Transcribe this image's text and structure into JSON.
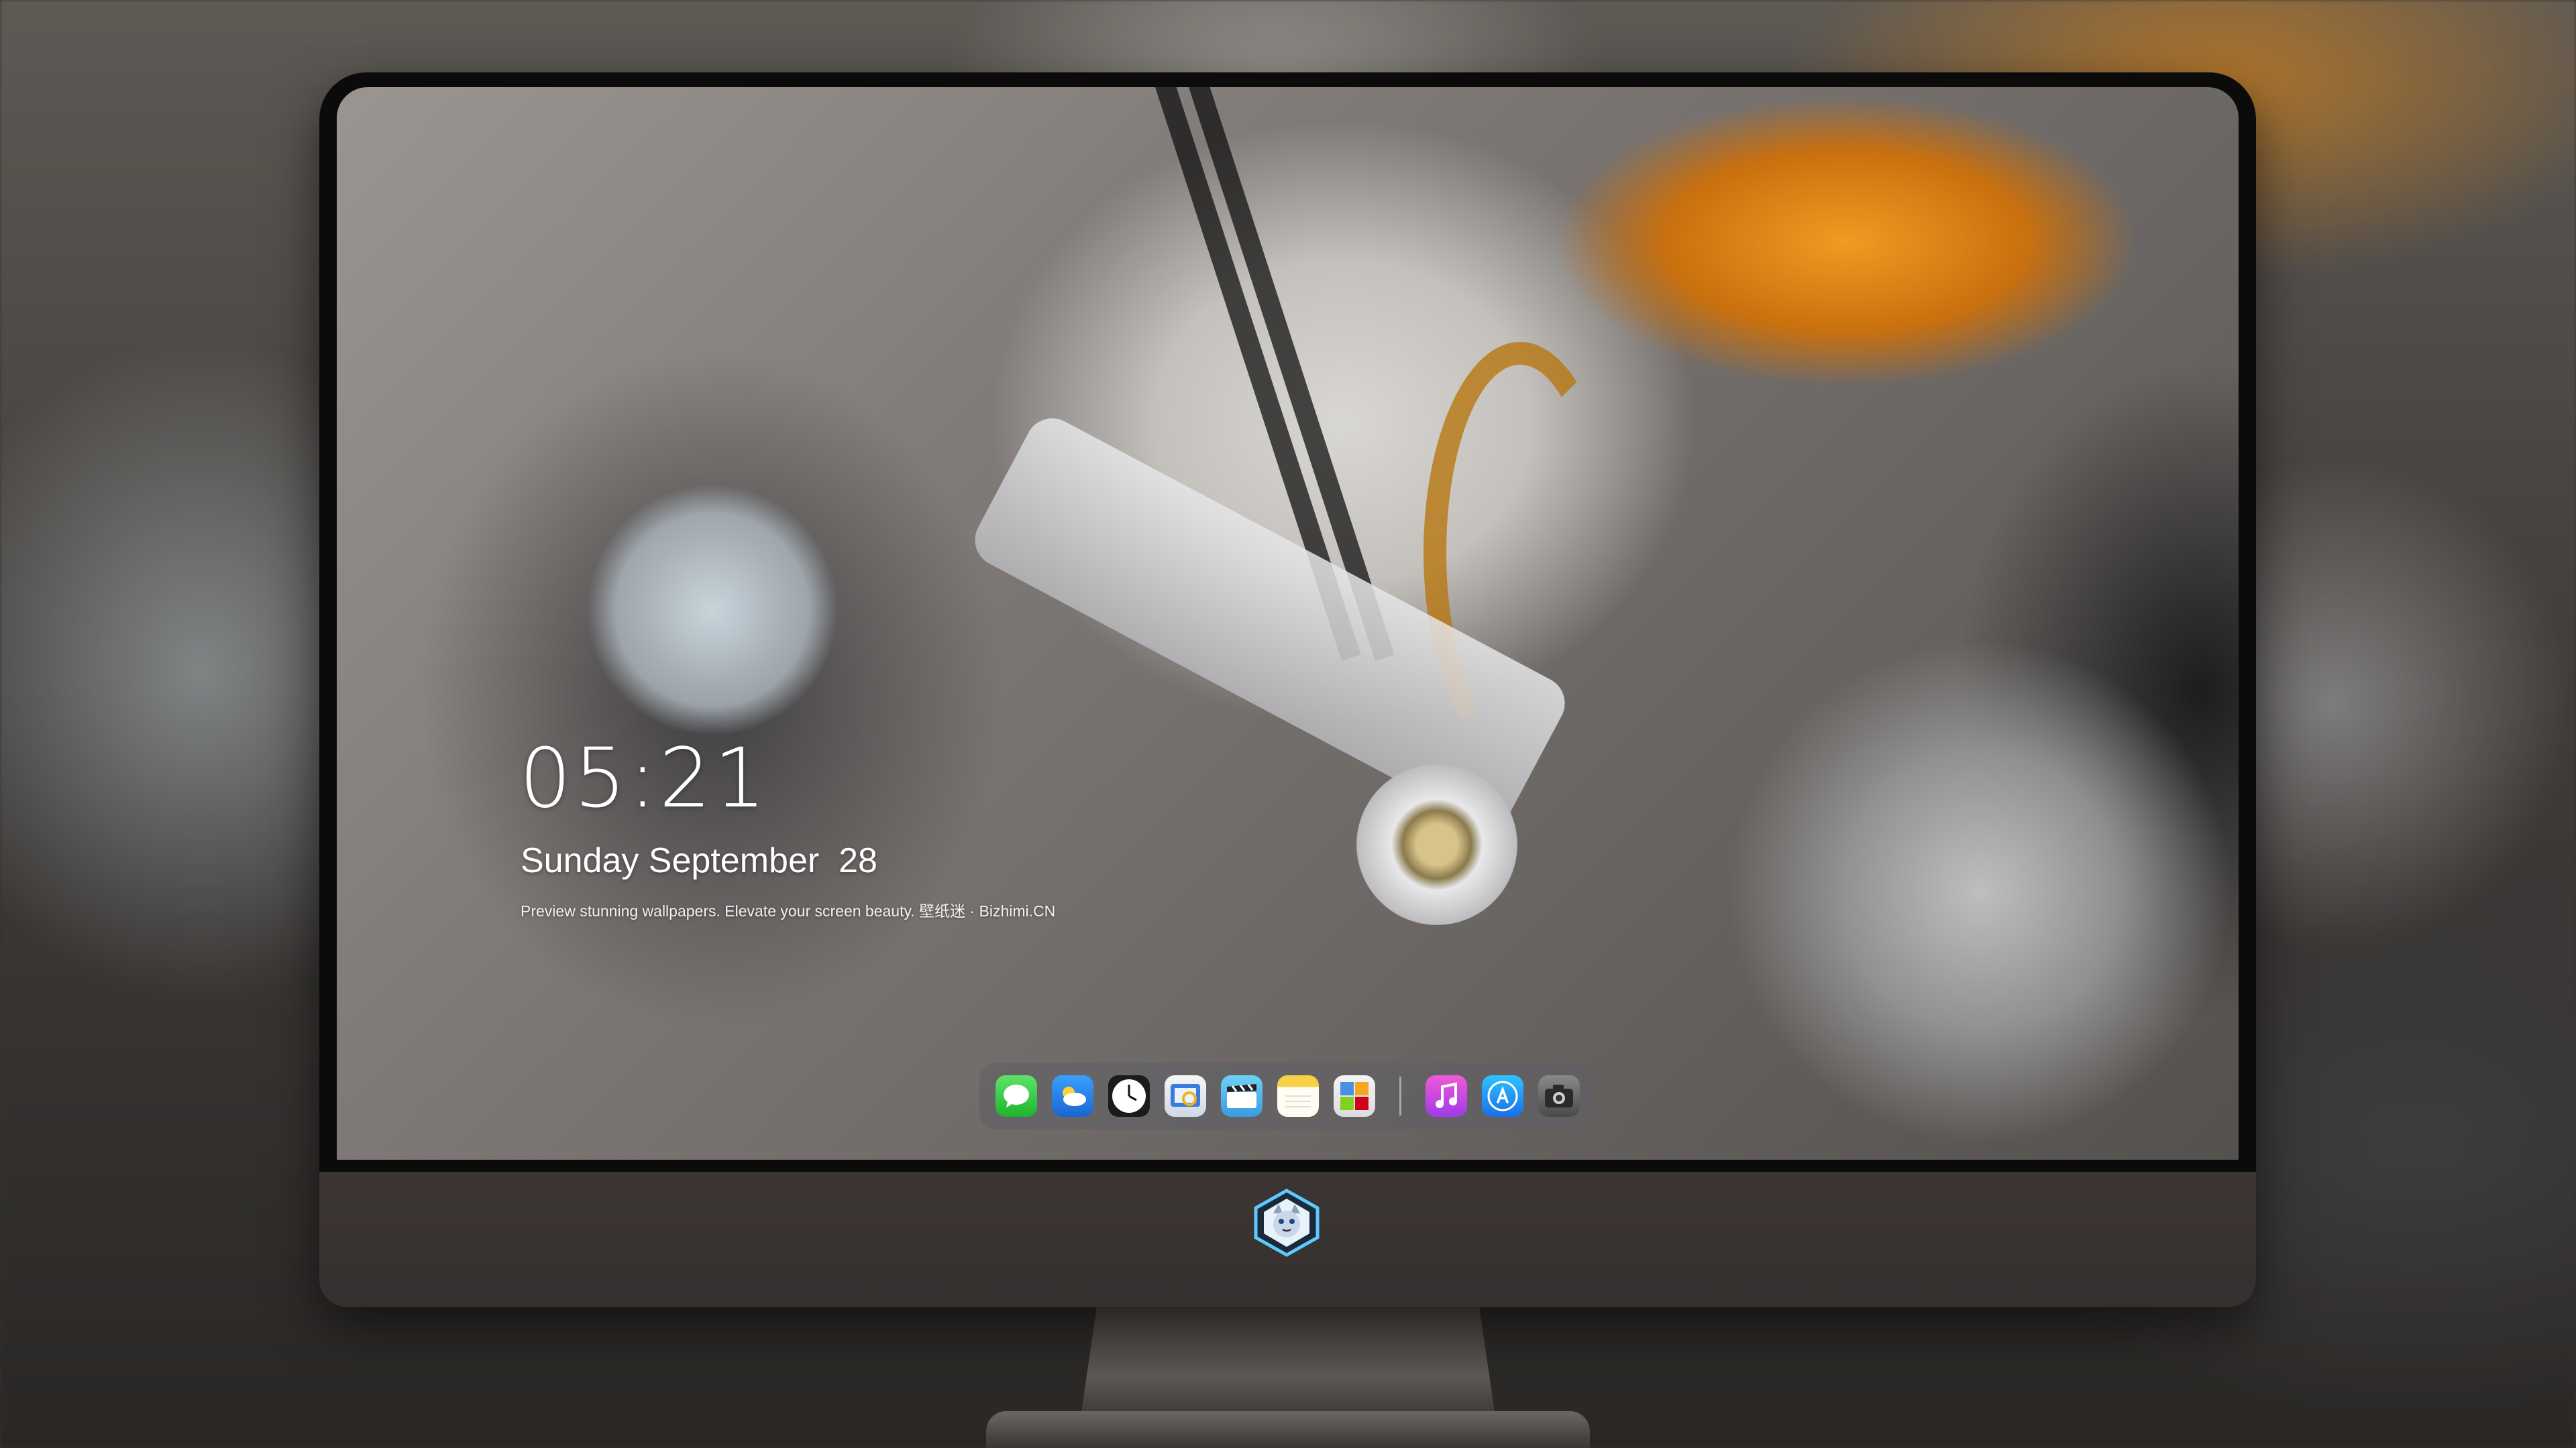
{
  "lock_screen": {
    "time": "05:21",
    "date": "Sunday September  28",
    "caption": "Preview stunning wallpapers. Elevate your screen beauty. 壁纸迷 · Bizhimi.CN"
  },
  "dock": {
    "apps": [
      {
        "name": "messages-icon",
        "color": "#2ecc40"
      },
      {
        "name": "weather-icon",
        "color": "#2f8ff0"
      },
      {
        "name": "clock-icon",
        "color": "#ffffff"
      },
      {
        "name": "preview-icon",
        "color": "#3a7be0"
      },
      {
        "name": "clips-icon",
        "color": "#5ab8e8"
      },
      {
        "name": "notes-icon",
        "color": "#f7d046"
      },
      {
        "name": "photos-icon",
        "color": "#4a90e2"
      },
      {
        "name": "music-icon",
        "color": "#e04ad0"
      },
      {
        "name": "app-store-icon",
        "color": "#2d8cf0"
      },
      {
        "name": "camera-icon",
        "color": "#555555"
      }
    ]
  },
  "brand": {
    "logo": "wolf-mascot-logo"
  }
}
